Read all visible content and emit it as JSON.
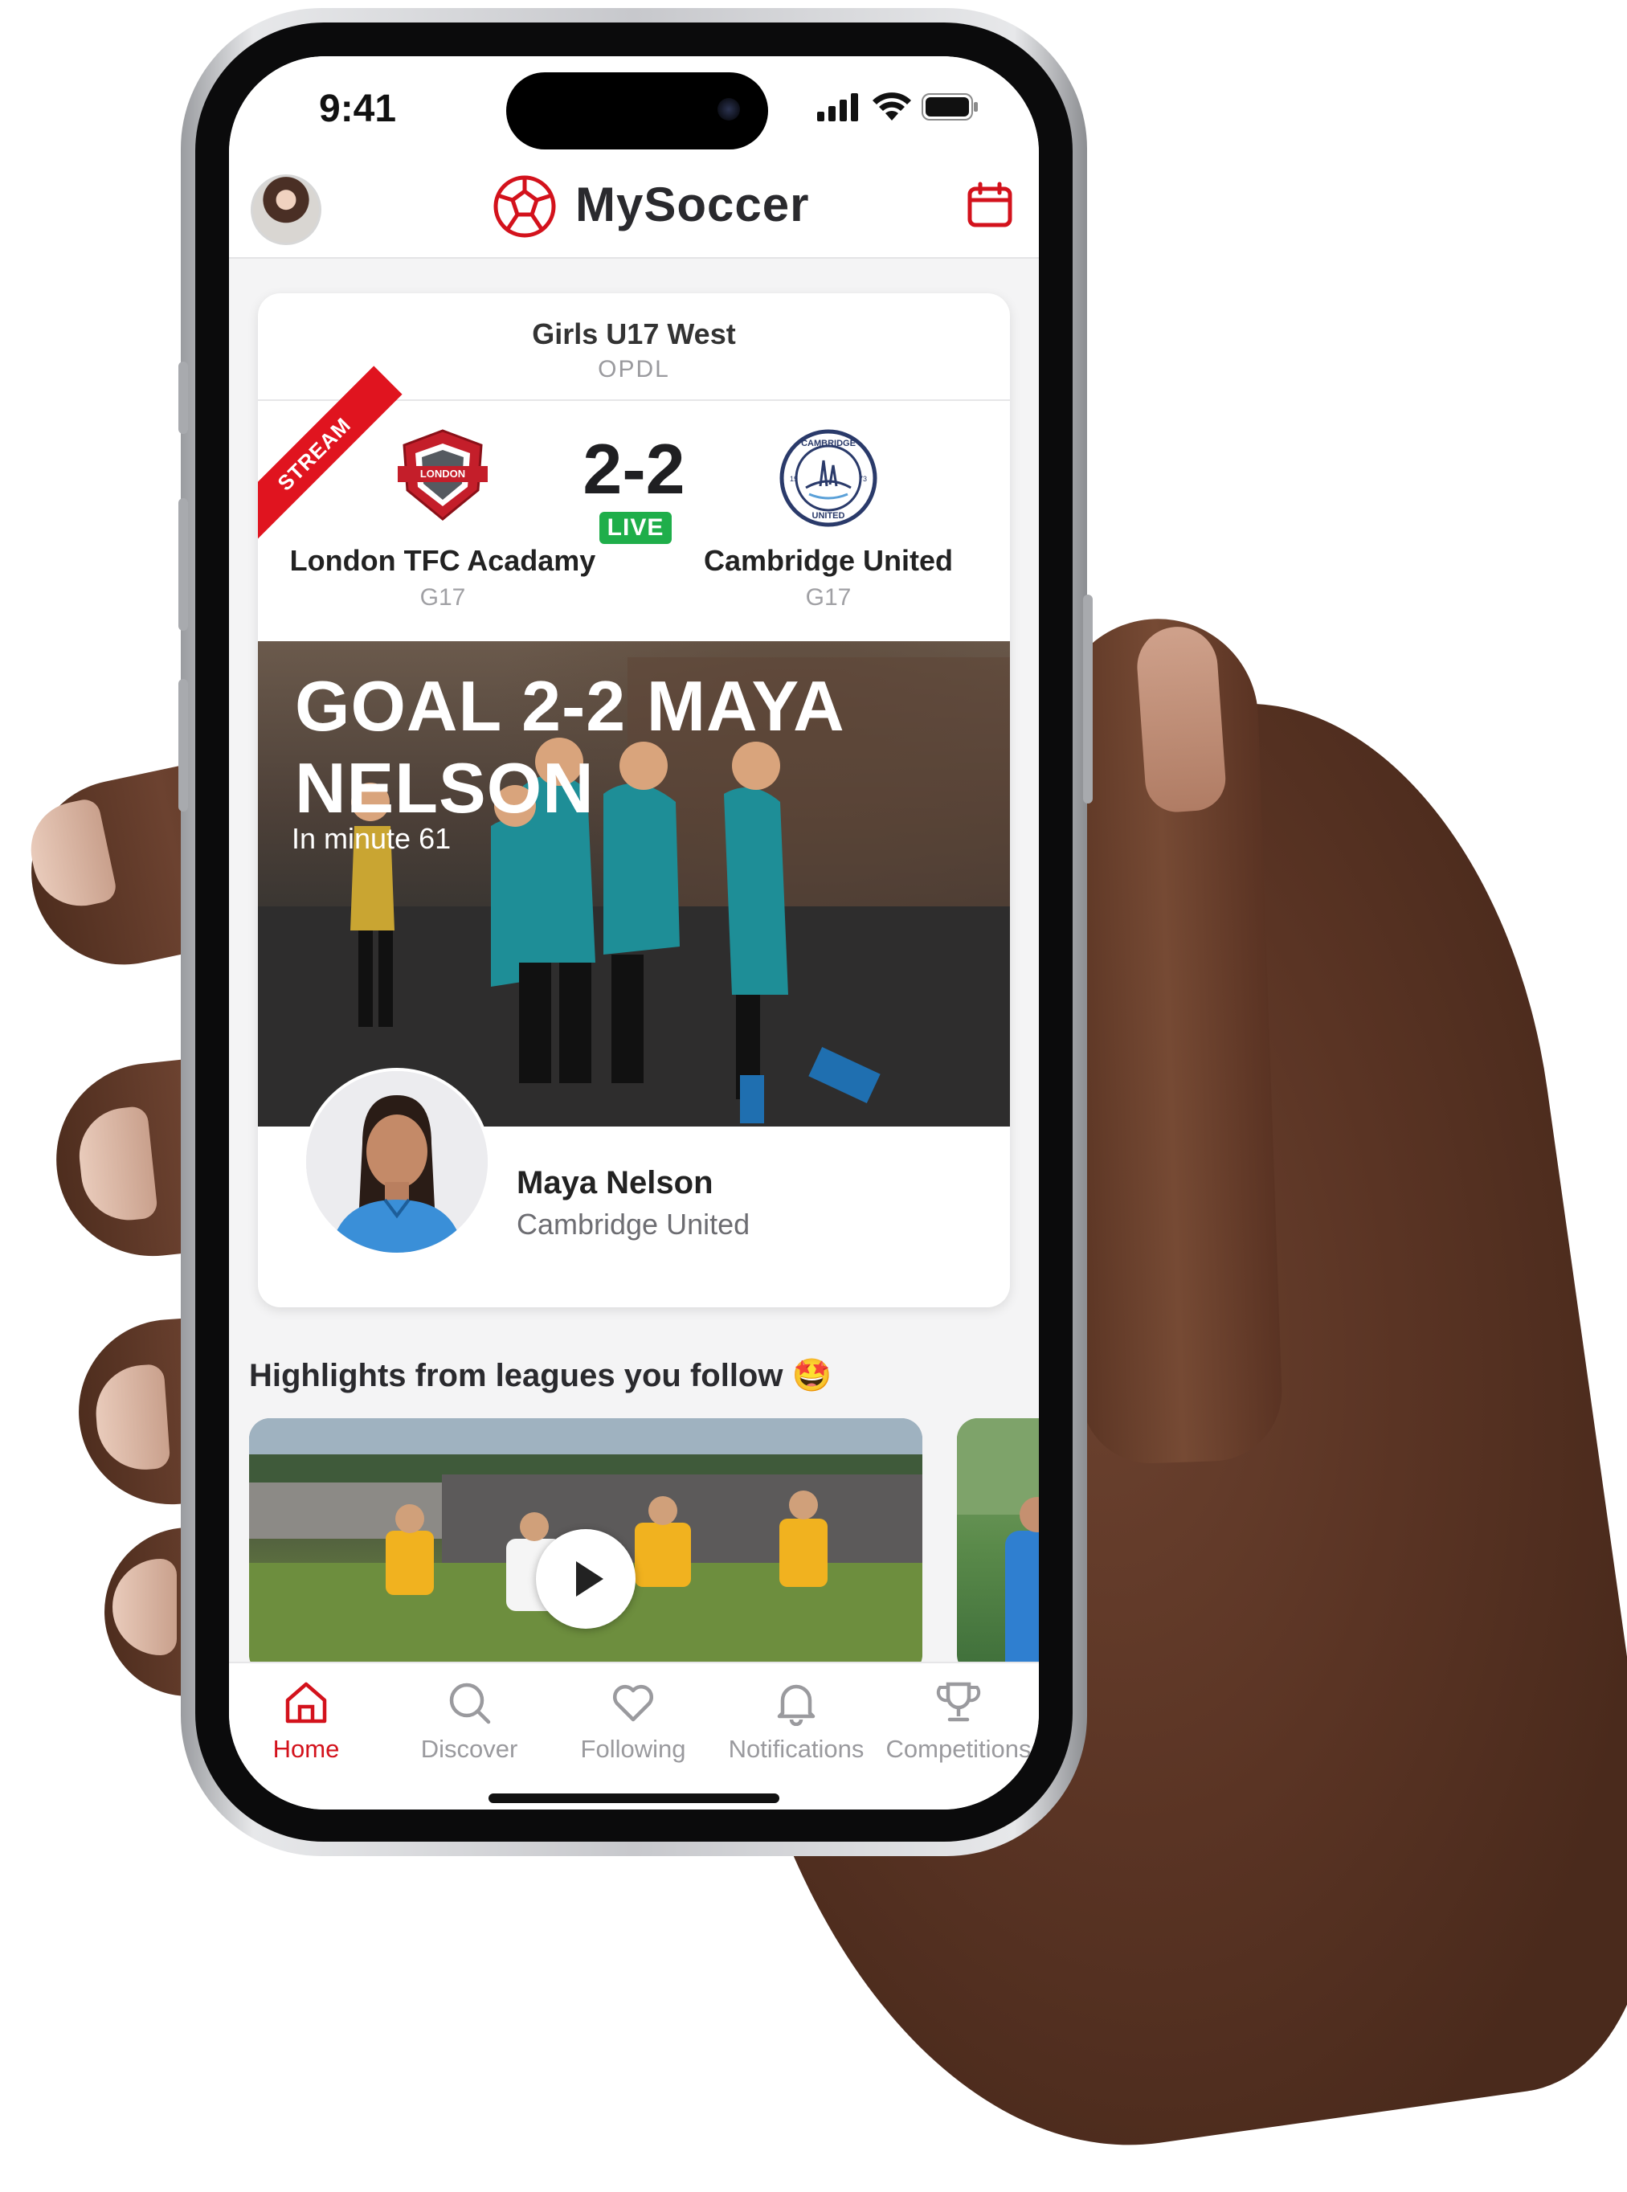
{
  "status_bar": {
    "time": "9:41"
  },
  "header": {
    "app_title": "MySoccer"
  },
  "match": {
    "league": "Girls U17 West",
    "league_sub": "OPDL",
    "stream_label": "STREAM",
    "score": "2-2",
    "live_label": "LIVE",
    "home_team": {
      "name": "London TFC Acadamy",
      "group": "G17",
      "crest_text": "LONDON"
    },
    "away_team": {
      "name": "Cambridge United",
      "group": "G17",
      "crest_text_top": "CAMBRIDGE",
      "crest_text_bottom": "UNITED",
      "crest_year_left": "19",
      "crest_year_right": "73"
    }
  },
  "goal_event": {
    "title": "GOAL 2-2 MAYA NELSON",
    "subtitle": "In minute 61",
    "player_name": "Maya Nelson",
    "player_team": "Cambridge United"
  },
  "highlights": {
    "section_title": "Highlights from leagues you follow 🤩"
  },
  "tabbar": {
    "home": "Home",
    "discover": "Discover",
    "following": "Following",
    "notifications": "Notifications",
    "competitions": "Competitions"
  },
  "colors": {
    "brand_red": "#d3121c",
    "live_green": "#1fae4a",
    "inactive_gray": "#9a9a9e"
  }
}
